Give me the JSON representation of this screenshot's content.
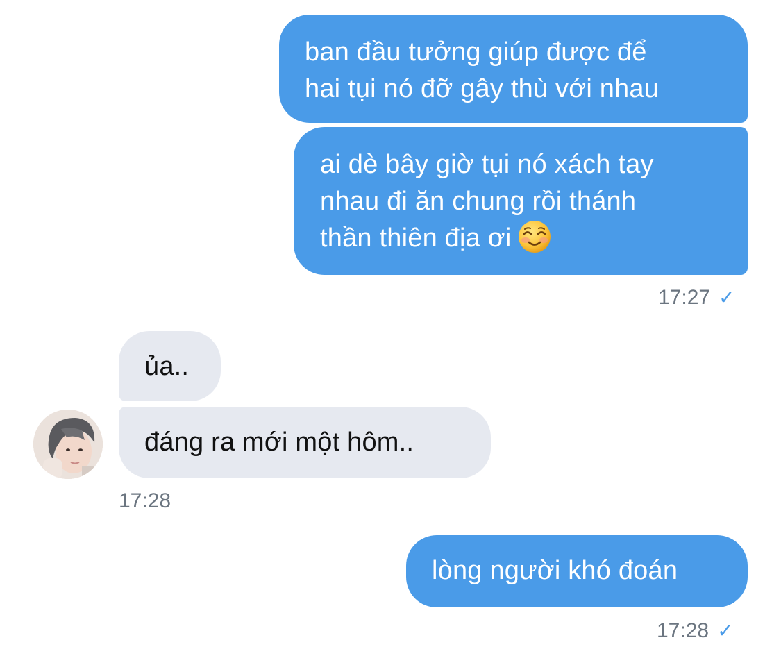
{
  "messages": [
    {
      "direction": "outgoing",
      "lines": [
        "ban đầu tưởng giúp được để",
        "hai tụi nó đỡ gây thù với nhau"
      ]
    },
    {
      "direction": "outgoing",
      "lines": [
        "ai dè bây giờ tụi nó xách tay",
        "nhau đi ăn chung rồi thánh",
        "thần thiên địa ơi"
      ],
      "emoji": "smiling-face-icon"
    },
    {
      "direction": "incoming",
      "lines": [
        "ủa.."
      ]
    },
    {
      "direction": "incoming",
      "lines": [
        "đáng ra mới một hôm.."
      ]
    },
    {
      "direction": "outgoing",
      "lines": [
        "lòng người khó đoán"
      ]
    }
  ],
  "timestamps": {
    "group1": "17:27",
    "group2": "17:28",
    "group3": "17:28"
  },
  "read_mark": "✓",
  "colors": {
    "sent_bubble": "#4a9be8",
    "received_bubble": "#e6e9f0",
    "timestamp": "#6b7580",
    "check": "#4a9be8"
  }
}
